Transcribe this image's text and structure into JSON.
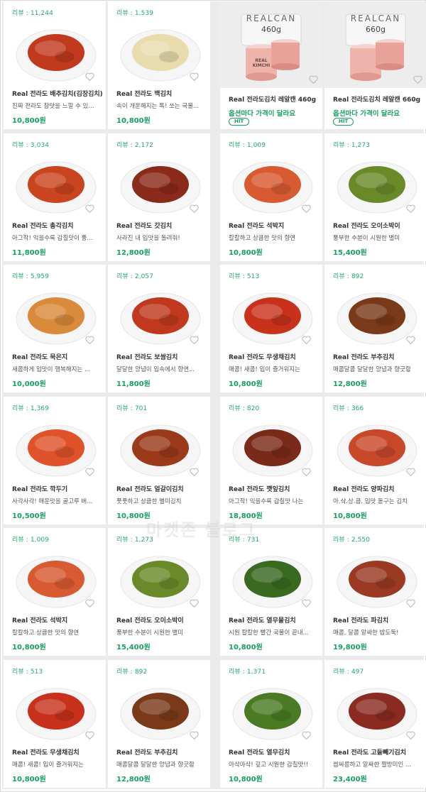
{
  "products": [
    {
      "review": "리뷰 : 11,244",
      "title": "Real 전라도 배추김치(김장김치)",
      "desc": "진짜 전라도 참맛을 느낄 수 있...",
      "price": "10,800원",
      "image_icon": "cabbage-kimchi-image",
      "color": "#c23a1e"
    },
    {
      "review": "리뷰 : 1,539",
      "title": "Real 전라도 백김치",
      "desc": "속이 개운해지는 톡! 쏘는 국물...",
      "price": "10,800원",
      "image_icon": "white-kimchi-image",
      "color": "#e8dcae"
    },
    {
      "title": "Real 전라도김치 레알캔 460g",
      "option": "옵션마다 가격이 달라요",
      "badge": "HIT",
      "brand": "REALCAN",
      "size": "460g",
      "can_label": "REAL KIMCHI",
      "image_icon": "kimchi-can-image",
      "color": "#e8a79e"
    },
    {
      "title": "Real 전라도김치 레알캔 660g",
      "option": "옵션마다 가격이 달라요",
      "badge": "HIT",
      "brand": "REALCAN",
      "size": "660g",
      "image_icon": "kimchi-can-image",
      "color": "#e8a79e"
    },
    {
      "review": "리뷰 : 3,034",
      "title": "Real 전라도 총각김치",
      "desc": "아그작! 익을수록 감칠맛이 풍...",
      "price": "11,800원",
      "image_icon": "ponytail-radish-kimchi-image",
      "color": "#c9451f"
    },
    {
      "review": "리뷰 : 2,172",
      "title": "Real 전라도 갓김치",
      "desc": "사라진 내 입맛을 돌려줘!",
      "price": "12,800원",
      "image_icon": "mustard-leaf-kimchi-image",
      "color": "#8a2a1a"
    },
    {
      "review": "리뷰 : 1,009",
      "title": "Real 전라도 석박지",
      "desc": "칼칼하고 상큼한 맛의 향연",
      "price": "10,800원",
      "image_icon": "radish-kimchi-image",
      "color": "#d85a32"
    },
    {
      "review": "리뷰 : 1,273",
      "title": "Real 전라도 오이소박이",
      "desc": "풍부한 수분이 시원한 별미",
      "price": "15,400원",
      "image_icon": "cucumber-kimchi-image",
      "color": "#6a8a2a"
    },
    {
      "review": "리뷰 : 5,959",
      "title": "Real 전라도 묵은지",
      "desc": "새콤하게 입맛이 행복해지는 ...",
      "price": "10,000원",
      "image_icon": "aged-kimchi-image",
      "color": "#d98a3a"
    },
    {
      "review": "리뷰 : 2,057",
      "title": "Real 전라도 보쌈김치",
      "desc": "달달한 양념이 입속에서 향연...",
      "price": "11,800원",
      "image_icon": "bossam-kimchi-image",
      "color": "#c0391e"
    },
    {
      "review": "리뷰 : 513",
      "title": "Real 전라도 무생채김치",
      "desc": "매콤! 새콤! 입이 즐거워지는",
      "price": "10,800원",
      "image_icon": "radish-salad-kimchi-image",
      "color": "#c8321c"
    },
    {
      "review": "리뷰 : 892",
      "title": "Real 전라도 부추김치",
      "desc": "매콤달콤 달달한 양념과 향긋함",
      "price": "12,800원",
      "image_icon": "chive-kimchi-image",
      "color": "#7a3a1a"
    },
    {
      "review": "리뷰 : 1,369",
      "title": "Real 전라도 깍두기",
      "desc": "사각사각! 매운맛을 골고루 버...",
      "price": "10,500원",
      "image_icon": "cubed-radish-kimchi-image",
      "color": "#e0522a"
    },
    {
      "review": "리뷰 : 701",
      "title": "Real 전라도 얼갈이김치",
      "desc": "풋풋하고 상큼한 별미김치",
      "price": "10,800원",
      "image_icon": "young-cabbage-kimchi-image",
      "color": "#9a3a1a"
    },
    {
      "review": "리뷰 : 820",
      "title": "Real 전라도 깻잎김치",
      "desc": "아그작! 익을수록 감칠맛 나는",
      "price": "18,800원",
      "image_icon": "perilla-leaf-kimchi-image",
      "color": "#7a2a18"
    },
    {
      "review": "리뷰 : 366",
      "title": "Real 전라도 양파김치",
      "desc": "아.삭.상.큼. 입맛 돋구는 김치",
      "price": "10,800원",
      "image_icon": "onion-kimchi-image",
      "color": "#c8482a"
    },
    {
      "review": "리뷰 : 1,009",
      "title": "Real 전라도 석박지",
      "desc": "칼칼하고 상큼한 맛의 향연",
      "price": "10,800원",
      "image_icon": "radish-kimchi-image",
      "color": "#d85a32"
    },
    {
      "review": "리뷰 : 1,273",
      "title": "Real 전라도 오이소박이",
      "desc": "풍부한 수분이 시원한 별미",
      "price": "15,400원",
      "image_icon": "cucumber-kimchi-image",
      "color": "#6a8a2a"
    },
    {
      "review": "리뷰 : 731",
      "title": "Real 전라도 열무물김치",
      "desc": "시원 칼칼한 빨간 국물이 끝내...",
      "price": "10,800원",
      "image_icon": "young-radish-water-kimchi-image",
      "color": "#3a6a20"
    },
    {
      "review": "리뷰 : 2,550",
      "title": "Real 전라도 파김치",
      "desc": "매콤, 달콤 알싸한 밥도둑!",
      "price": "19,800원",
      "image_icon": "green-onion-kimchi-image",
      "color": "#9a3a22"
    },
    {
      "review": "리뷰 : 513",
      "title": "Real 전라도 무생채김치",
      "desc": "매콤! 새콤! 입이 즐거워지는",
      "price": "10,800원",
      "image_icon": "radish-salad-kimchi-image",
      "color": "#c8321c"
    },
    {
      "review": "리뷰 : 892",
      "title": "Real 전라도 부추김치",
      "desc": "매콤달콤 달달한 양념과 향긋함",
      "price": "12,800원",
      "image_icon": "chive-kimchi-image",
      "color": "#7a3a1a"
    },
    {
      "review": "리뷰 : 1,371",
      "title": "Real 전라도 열무김치",
      "desc": "아삭아삭! 깊고 시원한 감칠맛!!",
      "price": "10,800원",
      "image_icon": "young-radish-kimchi-image",
      "color": "#4a7a24"
    },
    {
      "review": "리뷰 : 497",
      "title": "Real 전라도 고들빼기김치",
      "desc": "쌉싸름하고 알싸한 짤방미인 ...",
      "price": "23,400원",
      "image_icon": "godeulppaegi-kimchi-image",
      "color": "#8a2a20"
    }
  ],
  "watermark": "마켓존 블로그",
  "colors": {
    "accent": "#18a060",
    "background": "#ebebeb"
  }
}
